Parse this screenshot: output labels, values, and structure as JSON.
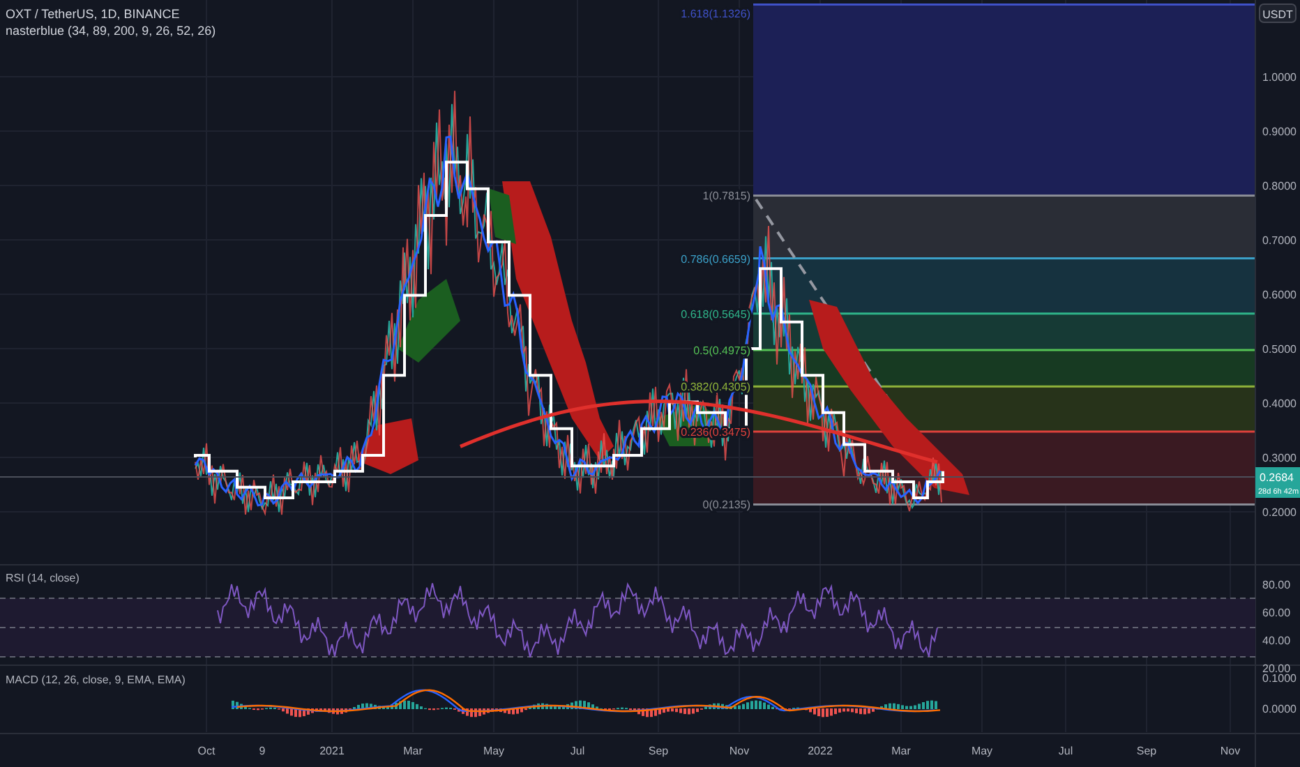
{
  "legend": {
    "symbol": "OXT / TetherUS, 1D, BINANCE",
    "indicator": "nasterblue (34, 89, 200, 9, 26, 52, 26)"
  },
  "price_axis": {
    "currency": "USDT",
    "ticks": [
      "1.0000",
      "0.9000",
      "0.8000",
      "0.7000",
      "0.6000",
      "0.5000",
      "0.4000",
      "0.3000",
      "0.2000"
    ],
    "last_price": "0.2684",
    "countdown": "28d 6h 42m"
  },
  "fib_levels": [
    {
      "label": "1.618(1.1326)",
      "color": "#3f51c8"
    },
    {
      "label": "1(0.7815)",
      "color": "#8a8d96"
    },
    {
      "label": "0.786(0.6659)",
      "color": "#3ba0c8"
    },
    {
      "label": "0.618(0.5645)",
      "color": "#2fb58a"
    },
    {
      "label": "0.5(0.4975)",
      "color": "#55c255"
    },
    {
      "label": "0.382(0.4305)",
      "color": "#8fb33a"
    },
    {
      "label": "0.236(0.3475)",
      "color": "#e0413c"
    },
    {
      "label": "0(0.2135)",
      "color": "#8a8d96"
    }
  ],
  "rsi": {
    "title": "RSI (14, close)",
    "ticks": [
      "80.00",
      "60.00",
      "40.00",
      "20.00"
    ]
  },
  "macd": {
    "title": "MACD (12, 26, close, 9, EMA, EMA)",
    "ticks": [
      "0.1000",
      "0.0000"
    ]
  },
  "time_axis": [
    "Oct",
    "9",
    "2021",
    "Mar",
    "May",
    "Jul",
    "Sep",
    "Nov",
    "2022",
    "Mar",
    "May",
    "Jul",
    "Sep",
    "Nov"
  ]
}
